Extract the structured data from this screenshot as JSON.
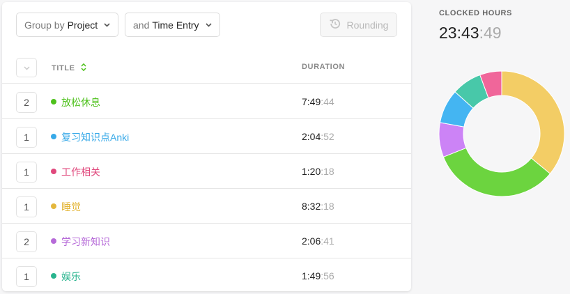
{
  "toolbar": {
    "group_by_prefix": "Group by",
    "group_by_value": "Project",
    "then_prefix": "and",
    "then_value": "Time Entry",
    "rounding_label": "Rounding"
  },
  "table": {
    "col_title": "TITLE",
    "col_duration": "DURATION",
    "rows": [
      {
        "count": "2",
        "title": "放松休息",
        "color": "#4ec11c",
        "duration_main": "7:49",
        "duration_sec": ":44"
      },
      {
        "count": "1",
        "title": "复习知识点Anki",
        "color": "#37a9e8",
        "duration_main": "2:04",
        "duration_sec": ":52"
      },
      {
        "count": "1",
        "title": "工作相关",
        "color": "#e0487c",
        "duration_main": "1:20",
        "duration_sec": ":18"
      },
      {
        "count": "1",
        "title": "睡觉",
        "color": "#e4b73c",
        "duration_main": "8:32",
        "duration_sec": ":18"
      },
      {
        "count": "2",
        "title": "学习新知识",
        "color": "#b66ad8",
        "duration_main": "2:06",
        "duration_sec": ":41"
      },
      {
        "count": "1",
        "title": "娱乐",
        "color": "#28b48e",
        "duration_main": "1:49",
        "duration_sec": ":56"
      }
    ]
  },
  "summary": {
    "label": "CLOCKED HOURS",
    "total_main": "23:43",
    "total_sec": ":49"
  },
  "donut": {
    "segments": [
      {
        "name": "睡觉",
        "color": "#f3cd65",
        "seconds": 30738
      },
      {
        "name": "放松休息",
        "color": "#6cd43f",
        "seconds": 28184
      },
      {
        "name": "学习新知识",
        "color": "#cc83f6",
        "seconds": 7601
      },
      {
        "name": "复习知识点Anki",
        "color": "#44b5f2",
        "seconds": 7492
      },
      {
        "name": "娱乐",
        "color": "#48c8a9",
        "seconds": 6596
      },
      {
        "name": "工作相关",
        "color": "#f0669a",
        "seconds": 4818
      }
    ]
  }
}
